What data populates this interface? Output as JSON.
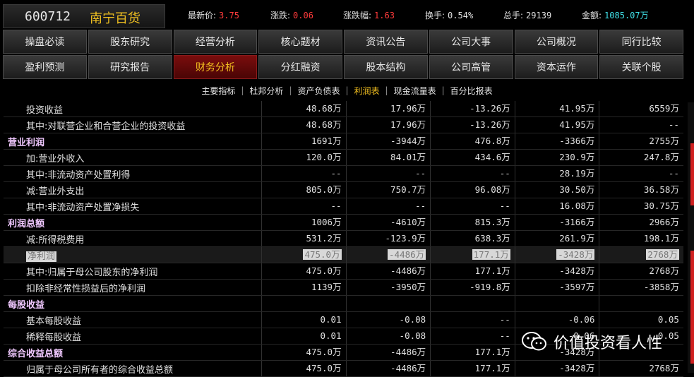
{
  "header": {
    "code": "600712",
    "name": "南宁百货",
    "metrics": [
      {
        "label": "最新价:",
        "value": "3.75",
        "color": "red"
      },
      {
        "label": "涨跌:",
        "value": "0.06",
        "color": "red"
      },
      {
        "label": "涨跌幅:",
        "value": "1.63",
        "color": "red"
      },
      {
        "label": "换手:",
        "value": "0.54%",
        "color": "white"
      },
      {
        "label": "总手:",
        "value": "29139",
        "color": "white"
      },
      {
        "label": "金额:",
        "value": "1085.07万",
        "color": "cyan"
      }
    ]
  },
  "nav": {
    "row1": [
      "操盘必读",
      "股东研究",
      "经营分析",
      "核心题材",
      "资讯公告",
      "公司大事",
      "公司概况",
      "同行比较"
    ],
    "row2": [
      "盈利预测",
      "研究报告",
      "财务分析",
      "分红融资",
      "股本结构",
      "公司高管",
      "资本运作",
      "关联个股"
    ],
    "active": "财务分析"
  },
  "subtabs": {
    "items": [
      "主要指标",
      "杜邦分析",
      "资产负债表",
      "利润表",
      "现金流量表",
      "百分比报表"
    ],
    "active": "利润表"
  },
  "table": {
    "rows": [
      {
        "label": "投资收益",
        "values": [
          "48.68万",
          "17.96万",
          "-13.26万",
          "41.95万",
          "6559万"
        ],
        "type": "normal"
      },
      {
        "label": "其中:对联营企业和合营企业的投资收益",
        "values": [
          "48.68万",
          "17.96万",
          "-13.26万",
          "41.95万",
          "--"
        ],
        "type": "normal"
      },
      {
        "label": "营业利润",
        "values": [
          "1691万",
          "-3944万",
          "476.8万",
          "-3366万",
          "2755万"
        ],
        "type": "section"
      },
      {
        "label": "加:营业外收入",
        "values": [
          "120.0万",
          "84.01万",
          "434.6万",
          "230.9万",
          "247.8万"
        ],
        "type": "normal"
      },
      {
        "label": "其中:非流动资产处置利得",
        "values": [
          "--",
          "--",
          "--",
          "28.19万",
          "--"
        ],
        "type": "normal"
      },
      {
        "label": "减:营业外支出",
        "values": [
          "805.0万",
          "750.7万",
          "96.08万",
          "30.50万",
          "36.58万"
        ],
        "type": "normal"
      },
      {
        "label": "其中:非流动资产处置净损失",
        "values": [
          "--",
          "--",
          "--",
          "16.08万",
          "30.75万"
        ],
        "type": "normal"
      },
      {
        "label": "利润总额",
        "values": [
          "1006万",
          "-4610万",
          "815.3万",
          "-3166万",
          "2966万"
        ],
        "type": "section"
      },
      {
        "label": "减:所得税费用",
        "values": [
          "531.2万",
          "-123.9万",
          "638.3万",
          "261.9万",
          "198.1万"
        ],
        "type": "normal"
      },
      {
        "label": "净利润",
        "values": [
          "475.0万",
          "-4486万",
          "177.1万",
          "-3428万",
          "2768万"
        ],
        "type": "highlight"
      },
      {
        "label": "其中:归属于母公司股东的净利润",
        "values": [
          "475.0万",
          "-4486万",
          "177.1万",
          "-3428万",
          "2768万"
        ],
        "type": "normal"
      },
      {
        "label": "扣除非经常性损益后的净利润",
        "values": [
          "1139万",
          "-3950万",
          "-919.8万",
          "-3597万",
          "-3858万"
        ],
        "type": "normal"
      },
      {
        "label": "每股收益",
        "values": [
          "",
          "",
          "",
          "",
          ""
        ],
        "type": "section"
      },
      {
        "label": "基本每股收益",
        "values": [
          "0.01",
          "-0.08",
          "--",
          "-0.06",
          "0.05"
        ],
        "type": "normal"
      },
      {
        "label": "稀释每股收益",
        "values": [
          "0.01",
          "-0.08",
          "--",
          "-0.06",
          "0.05"
        ],
        "type": "normal"
      },
      {
        "label": "综合收益总额",
        "values": [
          "475.0万",
          "-4486万",
          "177.1万",
          "-3428万",
          ""
        ],
        "type": "section"
      },
      {
        "label": "归属于母公司所有者的综合收益总额",
        "values": [
          "475.0万",
          "-4486万",
          "177.1万",
          "-3428万",
          "2768万"
        ],
        "type": "normal"
      }
    ]
  },
  "watermark": {
    "text": "价值投资看人性"
  },
  "colors": {
    "accent": "#f3c020",
    "price_up": "#ff3b3b",
    "amount": "#40e0e8",
    "active_tab_bg": "#7a0d0d"
  }
}
